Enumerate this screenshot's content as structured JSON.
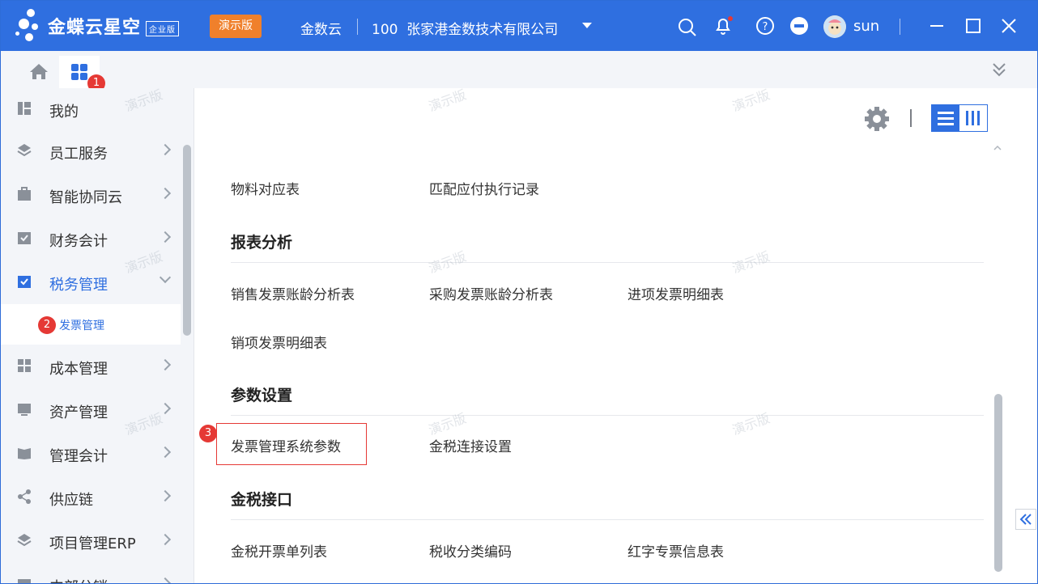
{
  "app": {
    "brand": "金蝶云星空",
    "edition_tag": "企业版",
    "demo_label": "演示版",
    "workspace": "金数云",
    "org_code": "100",
    "org_name": "张家港金数技术有限公司",
    "username": "sun",
    "brand_color": "#2f6fe0"
  },
  "tabs": {
    "home_icon": "home-icon",
    "apps_icon": "apps-grid-icon"
  },
  "callouts": {
    "one": "1",
    "two": "2",
    "three": "3"
  },
  "sidebar": {
    "items": [
      {
        "label": "我的",
        "icon": "dashboard-icon",
        "expandable": false
      },
      {
        "label": "员工服务",
        "icon": "layers-icon",
        "expandable": true
      },
      {
        "label": "智能协同云",
        "icon": "briefcase-icon",
        "expandable": true
      },
      {
        "label": "财务会计",
        "icon": "ledger-icon",
        "expandable": true
      },
      {
        "label": "税务管理",
        "icon": "tax-icon",
        "expandable": true,
        "expanded": true
      },
      {
        "label": "成本管理",
        "icon": "cost-icon",
        "expandable": true
      },
      {
        "label": "资产管理",
        "icon": "asset-icon",
        "expandable": true
      },
      {
        "label": "管理会计",
        "icon": "book-icon",
        "expandable": true
      },
      {
        "label": "供应链",
        "icon": "share-icon",
        "expandable": true
      },
      {
        "label": "项目管理ERP",
        "icon": "layers-icon",
        "expandable": true
      },
      {
        "label": "内部分销",
        "icon": "box-icon",
        "expandable": true
      }
    ],
    "sub_item": "发票管理"
  },
  "main": {
    "top_links": [
      "物料对应表",
      "匹配应付执行记录"
    ],
    "sections": [
      {
        "title": "报表分析",
        "links": [
          "销售发票账龄分析表",
          "采购发票账龄分析表",
          "进项发票明细表",
          "销项发票明细表"
        ]
      },
      {
        "title": "参数设置",
        "links": [
          "发票管理系统参数",
          "金税连接设置"
        ]
      },
      {
        "title": "金税接口",
        "links": [
          "金税开票单列表",
          "税收分类编码",
          "红字专票信息表"
        ]
      }
    ]
  },
  "watermark": "演示版"
}
